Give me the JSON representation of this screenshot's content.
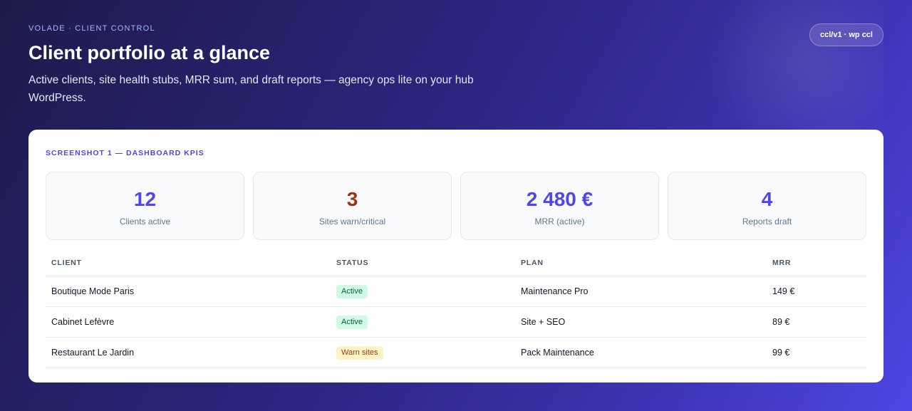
{
  "header": {
    "eyebrow": "VOLADE · CLIENT CONTROL",
    "title": "Client portfolio at a glance",
    "subtitle": "Active clients, site health stubs, MRR sum, and draft reports — agency ops lite on your hub WordPress.",
    "version_badge": "ccl/v1 · wp ccl"
  },
  "dashboard": {
    "section_label": "SCREENSHOT 1 — DASHBOARD KPIS",
    "kpis": [
      {
        "value": "12",
        "label": "Clients active"
      },
      {
        "value": "3",
        "label": "Sites warn/critical"
      },
      {
        "value": "2 480 €",
        "label": "MRR (active)"
      },
      {
        "value": "4",
        "label": "Reports draft"
      }
    ],
    "table": {
      "headers": [
        "CLIENT",
        "STATUS",
        "PLAN",
        "MRR"
      ],
      "rows": [
        {
          "client": "Boutique Mode Paris",
          "status": "Active",
          "plan": "Maintenance Pro",
          "mrr": "149 €"
        },
        {
          "client": "Cabinet Lefèvre",
          "status": "Active",
          "plan": "Site + SEO",
          "mrr": "89 €"
        },
        {
          "client": "Restaurant Le Jardin",
          "status": "Warn sites",
          "plan": "Pack Maintenance",
          "mrr": "99 €"
        }
      ]
    }
  },
  "colors": {
    "accent": "#4f46e5",
    "warn_value": "#9a3412",
    "status_active_bg": "#d1fae5",
    "status_warn_bg": "#fef3c7"
  }
}
